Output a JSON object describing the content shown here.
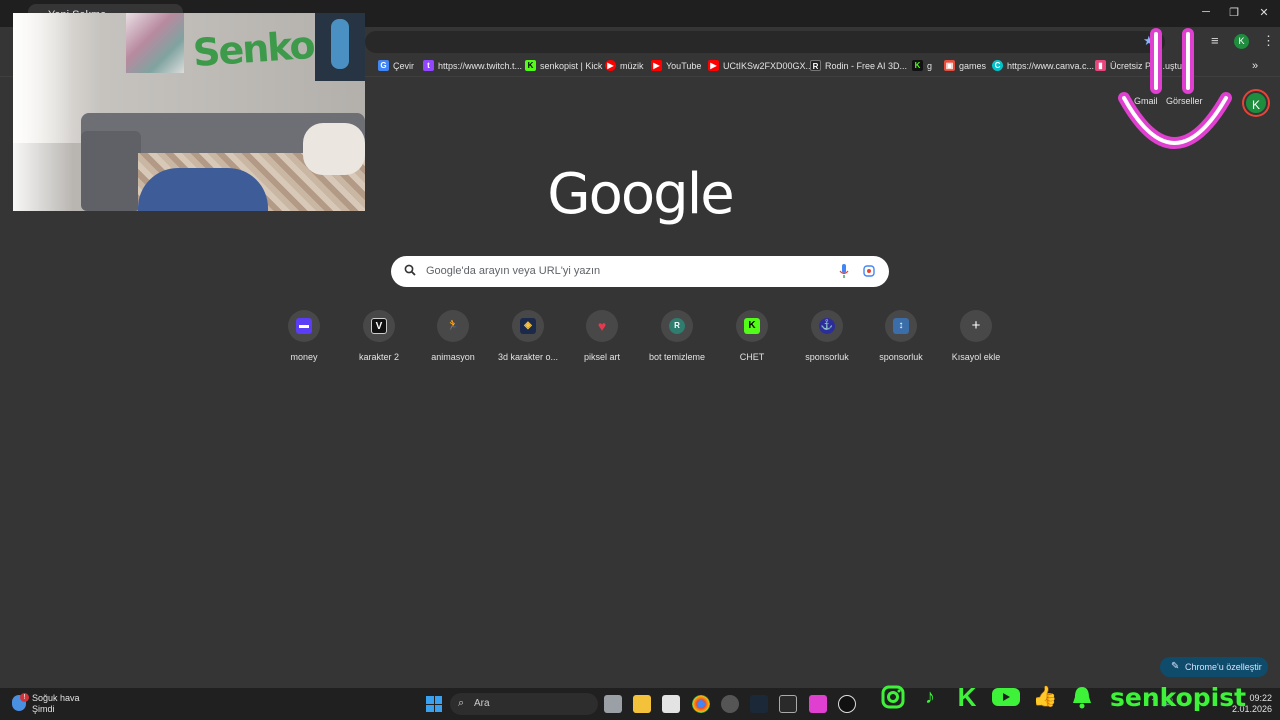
{
  "browser": {
    "tab_title": "Yeni Sekme",
    "window_controls": {
      "minimize": "─",
      "maximize": "❐",
      "close": "✕"
    },
    "profile_initial": "K"
  },
  "bookmarks": [
    {
      "label": "Çevir",
      "icon": "translate-icon",
      "color": "#4285f4"
    },
    {
      "label": "https://www.twitch.t...",
      "icon": "twitch-icon",
      "color": "#9146ff"
    },
    {
      "label": "senkopist | Kick",
      "icon": "kick-icon",
      "color": "#53fc18"
    },
    {
      "label": "müzik",
      "icon": "youtube-music-icon",
      "color": "#ff0000"
    },
    {
      "label": "YouTube",
      "icon": "youtube-icon",
      "color": "#ff0000"
    },
    {
      "label": "UCtIKSw2FXD00GX...",
      "icon": "youtube-icon",
      "color": "#ff0000"
    },
    {
      "label": "Rodin - Free AI 3D...",
      "icon": "rodin-icon",
      "color": "#222222"
    },
    {
      "label": "g",
      "icon": "kick-icon",
      "color": "#53fc18"
    },
    {
      "label": "games",
      "icon": "games-icon",
      "color": "#e74c3c"
    },
    {
      "label": "https://www.canva.c...",
      "icon": "canva-icon",
      "color": "#00c4cc"
    },
    {
      "label": "Ücretsiz PN...uştu...",
      "icon": "bookmark-icon",
      "color": "#e8457b"
    }
  ],
  "google": {
    "logo": "Google",
    "gmail": "Gmail",
    "images": "Görseller",
    "avatar_initial": "K",
    "search_placeholder": "Google'da arayın veya URL'yi yazın"
  },
  "shortcuts": [
    {
      "label": "money",
      "glyph": "▬",
      "color": "#5b3df5",
      "icon": "money-icon"
    },
    {
      "label": "karakter 2",
      "glyph": "V",
      "color": "#111111",
      "icon": "vroid-icon"
    },
    {
      "label": "animasyon",
      "glyph": "🏃",
      "color": "#484848",
      "icon": "mixamo-icon"
    },
    {
      "label": "3d karakter o...",
      "glyph": "◈",
      "color": "#1b2a4a",
      "icon": "3d-character-icon"
    },
    {
      "label": "piksel art",
      "glyph": "♥",
      "color": "#484848",
      "icon": "pixel-art-icon"
    },
    {
      "label": "bot temizleme",
      "glyph": "R",
      "color": "#2e7d6f",
      "icon": "r-letter-icon"
    },
    {
      "label": "CHET",
      "glyph": "K",
      "color": "#53fc18",
      "icon": "kick-icon"
    },
    {
      "label": "sponsorluk",
      "glyph": "⚓",
      "color": "#2d2d9a",
      "icon": "sponsor-icon"
    },
    {
      "label": "sponsorluk",
      "glyph": "↕",
      "color": "#3b6ea8",
      "icon": "sponsor-icon-2"
    },
    {
      "label": "Kısayol ekle",
      "glyph": "+",
      "color": "#484848",
      "icon": "add-icon"
    }
  ],
  "customize_label": "Chrome'u özelleştir",
  "overlay": {
    "handle": "senkopist",
    "accent": "#3ef23a",
    "smiley_color": "#e040d0",
    "webcam_wall_text": "Senko",
    "socials": [
      "instagram-icon",
      "tiktok-icon",
      "kick-icon",
      "youtube-icon",
      "thumbs-up-icon",
      "bell-icon"
    ]
  },
  "taskbar": {
    "weather_title": "Soğuk hava",
    "weather_sub": "Şimdi",
    "search_label": "Ara",
    "time": "09:22",
    "date": "2.01.2026"
  }
}
